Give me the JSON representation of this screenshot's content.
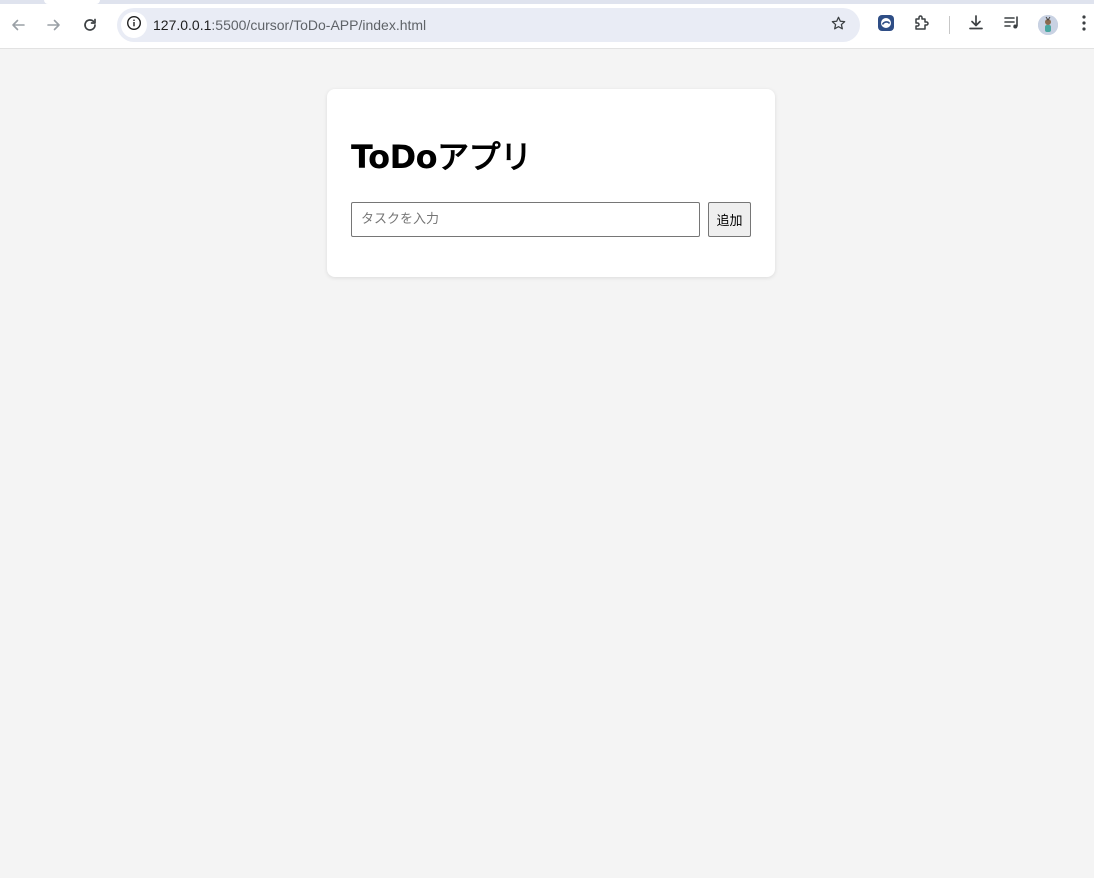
{
  "browser": {
    "url_host": "127.0.0.1",
    "url_path": ":5500/cursor/ToDo-APP/index.html",
    "icons": {
      "back": "back-arrow-icon",
      "forward": "forward-arrow-icon",
      "reload": "reload-icon",
      "site_info": "info-icon",
      "bookmark": "star-icon",
      "extension_app": "app-extension-icon",
      "extensions": "puzzle-icon",
      "downloads": "download-icon",
      "media": "media-queue-icon",
      "profile": "avatar",
      "menu": "kebab-menu-icon"
    }
  },
  "app": {
    "title": "ToDoアプリ",
    "input_placeholder": "タスクを入力",
    "input_value": "",
    "add_button_label": "追加"
  },
  "colors": {
    "page_background": "#f4f4f4",
    "card_background": "#ffffff",
    "omnibox_background": "#e9ecf5",
    "button_background": "#efefef"
  }
}
